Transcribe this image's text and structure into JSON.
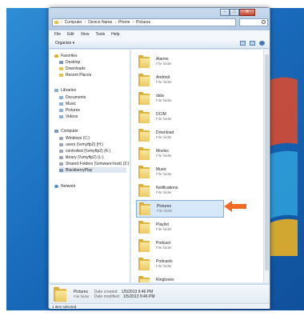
{
  "address_bar": {
    "segments": [
      "Computer",
      "Device Name",
      "Phone",
      "Pictures"
    ]
  },
  "search": {
    "placeholder": ""
  },
  "menubar": {
    "file": "File",
    "edit": "Edit",
    "view": "View",
    "tools": "Tools",
    "help": "Help"
  },
  "toolbar": {
    "organize": "Organize ▾"
  },
  "nav": {
    "favorites": "Favorites",
    "desktop": "Desktop",
    "downloads": "Downloads",
    "recent": "Recent Places",
    "libraries": "Libraries",
    "documents": "Documents",
    "music": "Music",
    "pictures": "Pictures",
    "videos": "Videos",
    "computer": "Computer",
    "windows_c": "Windows (C:)",
    "users": "users (\\\\vmyftp2) (H:)",
    "controlled": "controlled (\\\\vmyftp2) (K:)",
    "library": "library (\\\\vmyftp2) (L:)",
    "shared": "Shared Folders (\\\\vmware-host) (Z:)",
    "blackberry": "BlackberryPlay",
    "network": "Network"
  },
  "files": [
    {
      "name": "Alarms",
      "type": "File folder"
    },
    {
      "name": "Android",
      "type": "File folder"
    },
    {
      "name": "data",
      "type": "File folder"
    },
    {
      "name": "DCIM",
      "type": "File folder"
    },
    {
      "name": "Download",
      "type": "File folder"
    },
    {
      "name": "Movies",
      "type": "File folder"
    },
    {
      "name": "Music",
      "type": "File folder"
    },
    {
      "name": "Notifications",
      "type": "File folder"
    },
    {
      "name": "Pictures",
      "type": "File folder"
    },
    {
      "name": "Playlist",
      "type": "File folder"
    },
    {
      "name": "Podcast",
      "type": "File folder"
    },
    {
      "name": "Podcasts",
      "type": "File folder"
    },
    {
      "name": "Ringtones",
      "type": "File folder"
    }
  ],
  "selected_file": "Pictures",
  "details": {
    "name": "Pictures",
    "type": "File folder",
    "created_label": "Date created:",
    "created_value": "1/5/2013 9:46 PM",
    "modified_label": "Date modified:",
    "modified_value": "1/5/2013 9:46 PM"
  },
  "status": {
    "text": "1 item selected"
  },
  "colors": {
    "accent": "#f26a21",
    "selection": "#d7e8fb",
    "desktop": "#1a6cbd"
  }
}
